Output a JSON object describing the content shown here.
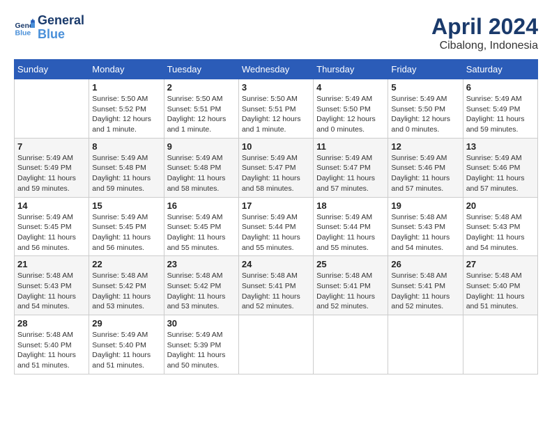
{
  "header": {
    "logo_line1": "General",
    "logo_line2": "Blue",
    "month": "April 2024",
    "location": "Cibalong, Indonesia"
  },
  "days_of_week": [
    "Sunday",
    "Monday",
    "Tuesday",
    "Wednesday",
    "Thursday",
    "Friday",
    "Saturday"
  ],
  "weeks": [
    [
      {
        "day": "",
        "info": ""
      },
      {
        "day": "1",
        "info": "Sunrise: 5:50 AM\nSunset: 5:52 PM\nDaylight: 12 hours\nand 1 minute."
      },
      {
        "day": "2",
        "info": "Sunrise: 5:50 AM\nSunset: 5:51 PM\nDaylight: 12 hours\nand 1 minute."
      },
      {
        "day": "3",
        "info": "Sunrise: 5:50 AM\nSunset: 5:51 PM\nDaylight: 12 hours\nand 1 minute."
      },
      {
        "day": "4",
        "info": "Sunrise: 5:49 AM\nSunset: 5:50 PM\nDaylight: 12 hours\nand 0 minutes."
      },
      {
        "day": "5",
        "info": "Sunrise: 5:49 AM\nSunset: 5:50 PM\nDaylight: 12 hours\nand 0 minutes."
      },
      {
        "day": "6",
        "info": "Sunrise: 5:49 AM\nSunset: 5:49 PM\nDaylight: 11 hours\nand 59 minutes."
      }
    ],
    [
      {
        "day": "7",
        "info": "Sunrise: 5:49 AM\nSunset: 5:49 PM\nDaylight: 11 hours\nand 59 minutes."
      },
      {
        "day": "8",
        "info": "Sunrise: 5:49 AM\nSunset: 5:48 PM\nDaylight: 11 hours\nand 59 minutes."
      },
      {
        "day": "9",
        "info": "Sunrise: 5:49 AM\nSunset: 5:48 PM\nDaylight: 11 hours\nand 58 minutes."
      },
      {
        "day": "10",
        "info": "Sunrise: 5:49 AM\nSunset: 5:47 PM\nDaylight: 11 hours\nand 58 minutes."
      },
      {
        "day": "11",
        "info": "Sunrise: 5:49 AM\nSunset: 5:47 PM\nDaylight: 11 hours\nand 57 minutes."
      },
      {
        "day": "12",
        "info": "Sunrise: 5:49 AM\nSunset: 5:46 PM\nDaylight: 11 hours\nand 57 minutes."
      },
      {
        "day": "13",
        "info": "Sunrise: 5:49 AM\nSunset: 5:46 PM\nDaylight: 11 hours\nand 57 minutes."
      }
    ],
    [
      {
        "day": "14",
        "info": "Sunrise: 5:49 AM\nSunset: 5:45 PM\nDaylight: 11 hours\nand 56 minutes."
      },
      {
        "day": "15",
        "info": "Sunrise: 5:49 AM\nSunset: 5:45 PM\nDaylight: 11 hours\nand 56 minutes."
      },
      {
        "day": "16",
        "info": "Sunrise: 5:49 AM\nSunset: 5:45 PM\nDaylight: 11 hours\nand 55 minutes."
      },
      {
        "day": "17",
        "info": "Sunrise: 5:49 AM\nSunset: 5:44 PM\nDaylight: 11 hours\nand 55 minutes."
      },
      {
        "day": "18",
        "info": "Sunrise: 5:49 AM\nSunset: 5:44 PM\nDaylight: 11 hours\nand 55 minutes."
      },
      {
        "day": "19",
        "info": "Sunrise: 5:48 AM\nSunset: 5:43 PM\nDaylight: 11 hours\nand 54 minutes."
      },
      {
        "day": "20",
        "info": "Sunrise: 5:48 AM\nSunset: 5:43 PM\nDaylight: 11 hours\nand 54 minutes."
      }
    ],
    [
      {
        "day": "21",
        "info": "Sunrise: 5:48 AM\nSunset: 5:43 PM\nDaylight: 11 hours\nand 54 minutes."
      },
      {
        "day": "22",
        "info": "Sunrise: 5:48 AM\nSunset: 5:42 PM\nDaylight: 11 hours\nand 53 minutes."
      },
      {
        "day": "23",
        "info": "Sunrise: 5:48 AM\nSunset: 5:42 PM\nDaylight: 11 hours\nand 53 minutes."
      },
      {
        "day": "24",
        "info": "Sunrise: 5:48 AM\nSunset: 5:41 PM\nDaylight: 11 hours\nand 52 minutes."
      },
      {
        "day": "25",
        "info": "Sunrise: 5:48 AM\nSunset: 5:41 PM\nDaylight: 11 hours\nand 52 minutes."
      },
      {
        "day": "26",
        "info": "Sunrise: 5:48 AM\nSunset: 5:41 PM\nDaylight: 11 hours\nand 52 minutes."
      },
      {
        "day": "27",
        "info": "Sunrise: 5:48 AM\nSunset: 5:40 PM\nDaylight: 11 hours\nand 51 minutes."
      }
    ],
    [
      {
        "day": "28",
        "info": "Sunrise: 5:48 AM\nSunset: 5:40 PM\nDaylight: 11 hours\nand 51 minutes."
      },
      {
        "day": "29",
        "info": "Sunrise: 5:49 AM\nSunset: 5:40 PM\nDaylight: 11 hours\nand 51 minutes."
      },
      {
        "day": "30",
        "info": "Sunrise: 5:49 AM\nSunset: 5:39 PM\nDaylight: 11 hours\nand 50 minutes."
      },
      {
        "day": "",
        "info": ""
      },
      {
        "day": "",
        "info": ""
      },
      {
        "day": "",
        "info": ""
      },
      {
        "day": "",
        "info": ""
      }
    ]
  ]
}
